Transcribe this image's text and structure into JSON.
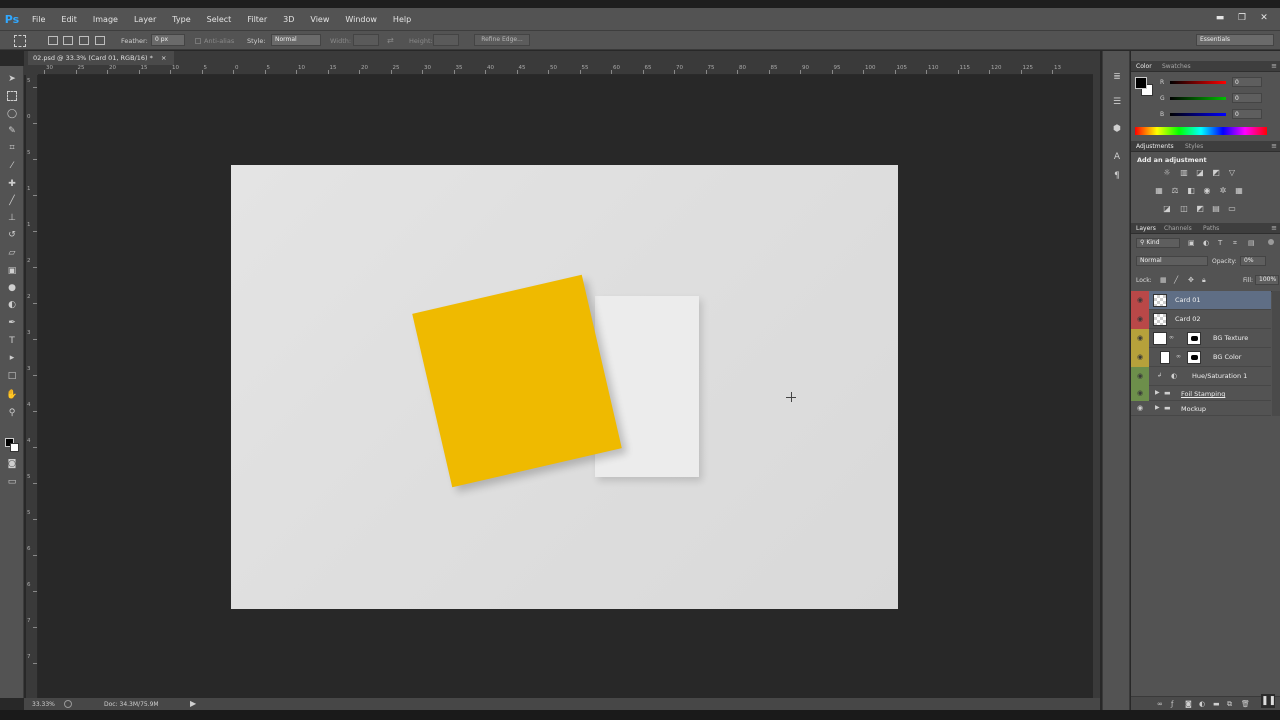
{
  "app": {
    "logo": "Ps"
  },
  "menu": [
    "File",
    "Edit",
    "Image",
    "Layer",
    "Type",
    "Select",
    "Filter",
    "3D",
    "View",
    "Window",
    "Help"
  ],
  "window_controls": {
    "minimize": "▬",
    "restore": "❐",
    "close": "✕"
  },
  "options": {
    "feather_label": "Feather:",
    "feather_value": "0 px",
    "antialias_label": "Anti-alias",
    "style_label": "Style:",
    "style_value": "Normal",
    "width_label": "Width:",
    "height_label": "Height:",
    "refine_edge": "Refine Edge...",
    "workspace": "Essentials"
  },
  "document": {
    "tab_title": "02.psd @ 33.3% (Card 01, RGB/16) *",
    "tab_close": "×"
  },
  "ruler": {
    "h_ticks": [
      "30",
      "25",
      "20",
      "15",
      "10",
      "5",
      "0",
      "5",
      "10",
      "15",
      "20",
      "25",
      "30",
      "35",
      "40",
      "45",
      "50",
      "55",
      "60",
      "65",
      "70",
      "75",
      "80",
      "85",
      "90",
      "95",
      "100",
      "105",
      "110",
      "115",
      "120",
      "125",
      "13"
    ],
    "v_ticks": [
      "5",
      "0",
      "5",
      "1",
      "1",
      "2",
      "2",
      "3",
      "3",
      "4",
      "4",
      "5",
      "5",
      "6",
      "6",
      "7",
      "7"
    ]
  },
  "status": {
    "zoom": "33.33%",
    "doc": "Doc: 34.3M/75.9M"
  },
  "color_panel": {
    "tabs": [
      "Color",
      "Swatches"
    ],
    "channels": [
      {
        "label": "R",
        "value": "0",
        "color": "#ff0000"
      },
      {
        "label": "G",
        "value": "0",
        "color": "#00c000"
      },
      {
        "label": "B",
        "value": "0",
        "color": "#0000ff"
      }
    ],
    "foreground": "#000000",
    "background": "#ffffff"
  },
  "adjustments_panel": {
    "tabs": [
      "Adjustments",
      "Styles"
    ],
    "title": "Add an adjustment"
  },
  "layers_panel": {
    "tabs": [
      "Layers",
      "Channels",
      "Paths"
    ],
    "filter_kind": "Kind",
    "blend_mode": "Normal",
    "opacity_label": "Opacity:",
    "opacity_value": "0%",
    "lock_label": "Lock:",
    "fill_label": "Fill:",
    "fill_value": "100%",
    "layers": [
      {
        "name": "Card 01",
        "eye_color": "#b94848"
      },
      {
        "name": "Card 02",
        "eye_color": "#b94848"
      },
      {
        "name": "BG Texture",
        "eye_color": "#b6a13b"
      },
      {
        "name": "BG Color",
        "eye_color": "#b6a13b"
      },
      {
        "name": "Hue/Saturation 1",
        "eye_color": "#6d8f4b"
      },
      {
        "name": "Foil Stamping",
        "eye_color": "#6d8f4b"
      },
      {
        "name": "Mockup",
        "eye_color": "#535353"
      }
    ]
  },
  "canvas_colors": {
    "card01": "#efba00",
    "card02": "#ececec",
    "background": "#e0e0e0"
  }
}
